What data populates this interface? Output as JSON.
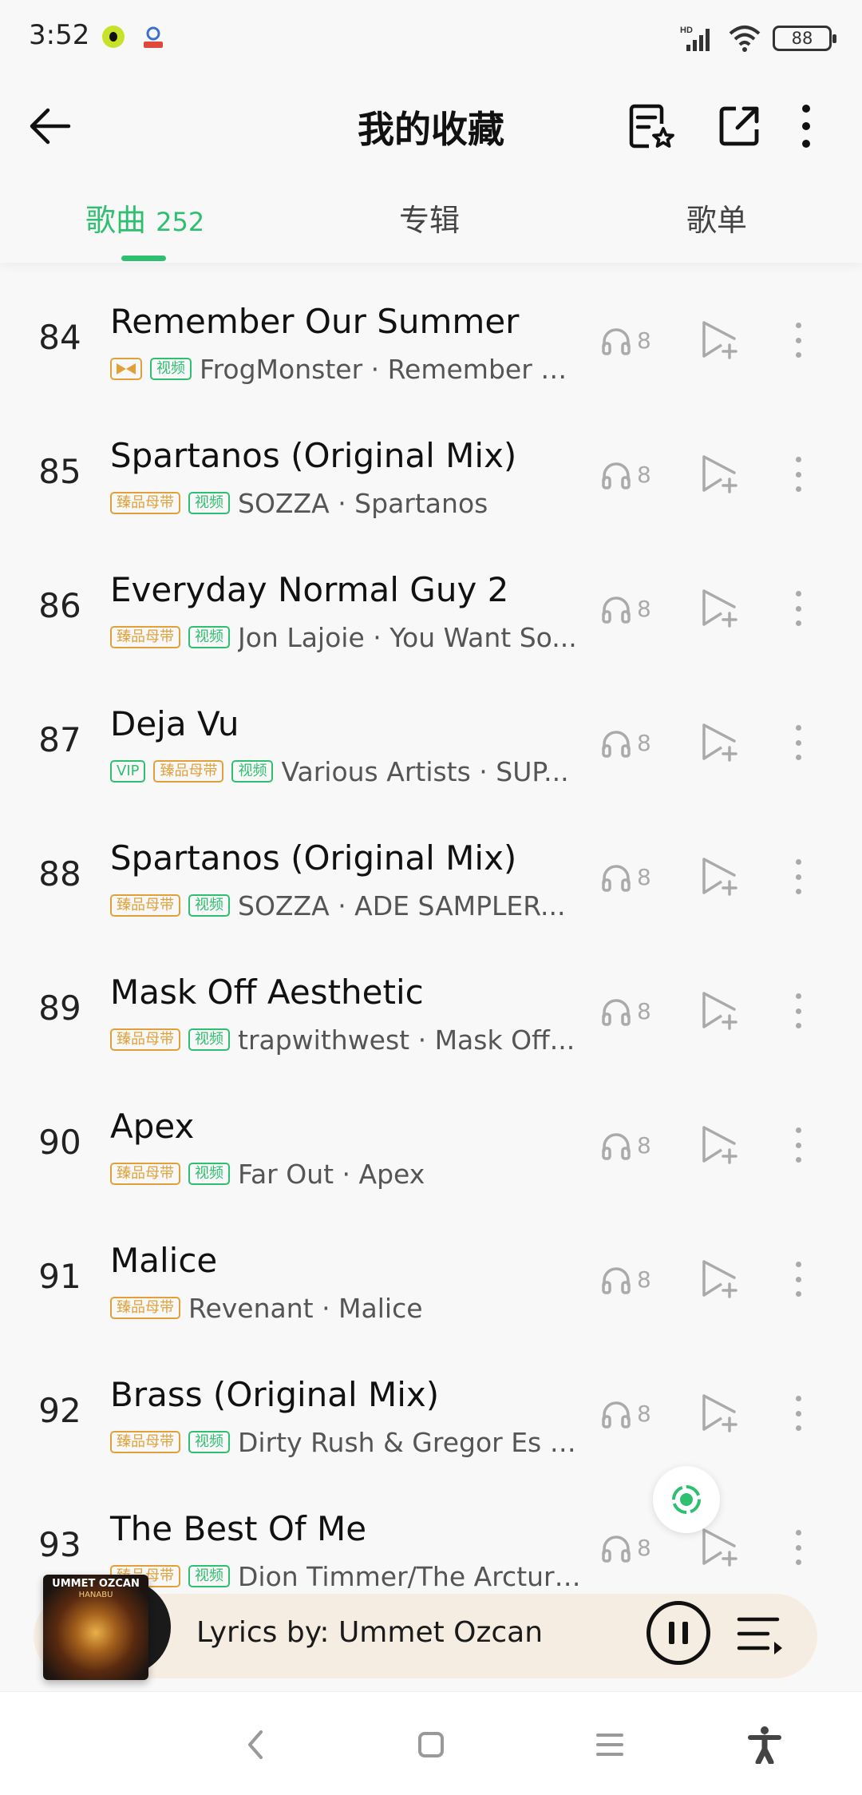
{
  "status_bar": {
    "time": "3:52",
    "network": "HD",
    "battery": "88",
    "icons": [
      "qq-music-icon",
      "baidu-icon",
      "signal-icon",
      "wifi-icon",
      "battery-icon"
    ]
  },
  "header": {
    "title": "我的收藏",
    "icons": [
      "back-arrow-icon",
      "playlist-star-icon",
      "share-icon",
      "more-vertical-icon"
    ]
  },
  "tabs": [
    {
      "label": "歌曲",
      "count": "252",
      "active": true
    },
    {
      "label": "专辑",
      "active": false
    },
    {
      "label": "歌单",
      "active": false
    }
  ],
  "songs": [
    {
      "rank": "84",
      "title": "Remember Our Summer",
      "tags": [
        "dolby-icon",
        "视频"
      ],
      "subtitle": "FrogMonster · Remember O...",
      "listen_count": "8"
    },
    {
      "rank": "85",
      "title": "Spartanos (Original Mix)",
      "tags": [
        "臻品母带",
        "视频"
      ],
      "subtitle": "SOZZA · Spartanos",
      "listen_count": "8"
    },
    {
      "rank": "86",
      "title": "Everyday Normal Guy 2",
      "tags": [
        "臻品母带",
        "视频"
      ],
      "subtitle": "Jon Lajoie · You Want So...",
      "listen_count": "8"
    },
    {
      "rank": "87",
      "title": "Deja Vu",
      "tags": [
        "VIP",
        "臻品母带",
        "视频"
      ],
      "subtitle": "Various Artists · SUP...",
      "listen_count": "8"
    },
    {
      "rank": "88",
      "title": "Spartanos (Original Mix)",
      "tags": [
        "臻品母带",
        "视频"
      ],
      "subtitle": "SOZZA · ADE SAMPLER...",
      "listen_count": "8"
    },
    {
      "rank": "89",
      "title": "Mask Off Aesthetic",
      "tags": [
        "臻品母带",
        "视频"
      ],
      "subtitle": "trapwithwest · Mask Off...",
      "listen_count": "8"
    },
    {
      "rank": "90",
      "title": "Apex",
      "tags": [
        "臻品母带",
        "视频"
      ],
      "subtitle": "Far Out · Apex",
      "listen_count": "8"
    },
    {
      "rank": "91",
      "title": "Malice",
      "tags": [
        "臻品母带"
      ],
      "subtitle": "Revenant · Malice",
      "listen_count": "8"
    },
    {
      "rank": "92",
      "title": "Brass (Original Mix)",
      "tags": [
        "臻品母带",
        "视频"
      ],
      "subtitle": "Dirty Rush & Gregor Es · ...",
      "listen_count": "8"
    },
    {
      "rank": "93",
      "title": "The Best Of Me",
      "tags": [
        "臻品母带",
        "视频"
      ],
      "subtitle": "Dion Timmer/The Arcturi...",
      "listen_count": "8"
    }
  ],
  "player": {
    "album_artist": "UMMET OZCAN",
    "album_name": "HANABU",
    "now_playing": "Lyrics by: Ummet Ozcan"
  },
  "colors": {
    "accent": "#2fbf71",
    "gold_tag": "#e0a13a",
    "background": "#f8f8f8",
    "player_bg": "#f6ede2"
  }
}
